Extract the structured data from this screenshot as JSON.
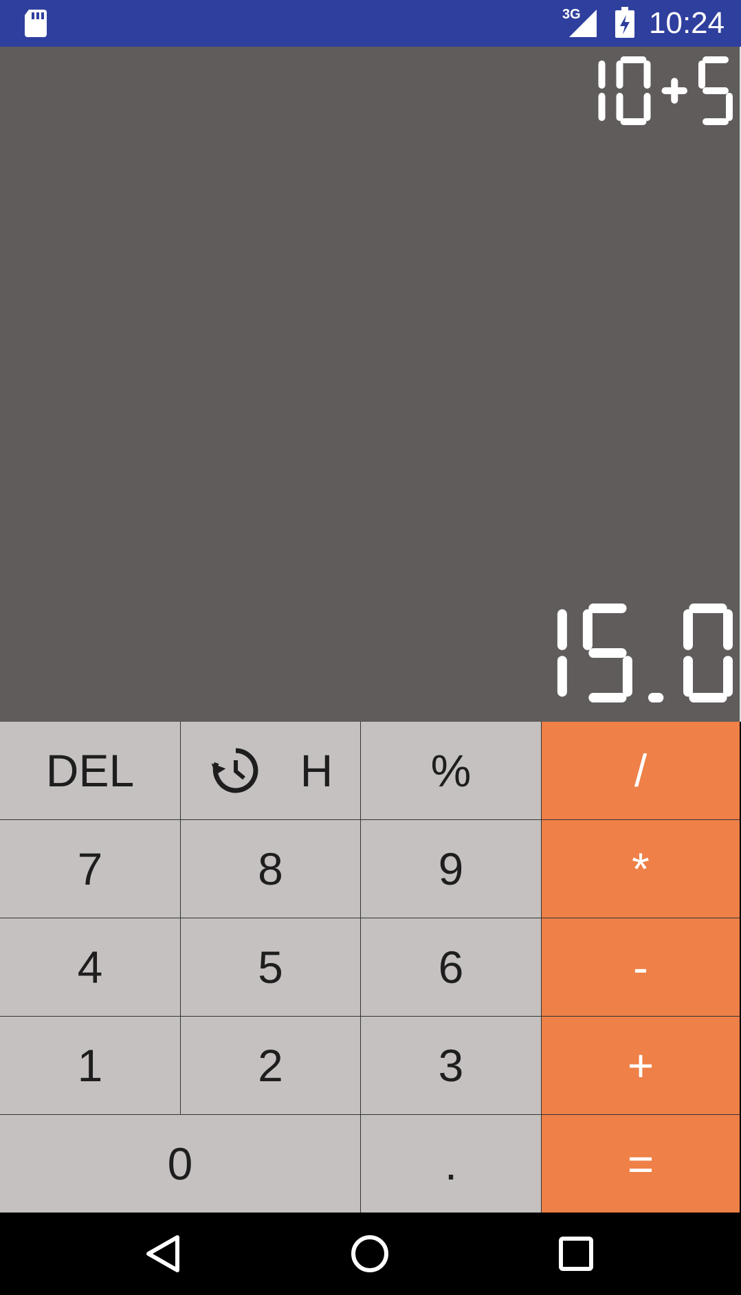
{
  "status_bar": {
    "network": "3G",
    "time": "10:24",
    "icons": [
      "sd-card-icon",
      "signal-icon",
      "battery-charging-icon"
    ]
  },
  "display": {
    "expression": "10+5",
    "result": "15.0"
  },
  "keypad": {
    "rows": [
      [
        "DEL",
        "H",
        "%",
        "/"
      ],
      [
        "7",
        "8",
        "9",
        "*"
      ],
      [
        "4",
        "5",
        "6",
        "-"
      ],
      [
        "1",
        "2",
        "3",
        "+"
      ],
      [
        "0",
        ".",
        "="
      ]
    ]
  },
  "colors": {
    "status_bar": "#2f3f9e",
    "display_bg": "#605c5b",
    "key_bg": "#c5c1c0",
    "operator_bg": "#ee8048"
  },
  "nav_bar": {
    "icons": [
      "back-icon",
      "home-icon",
      "recents-icon"
    ]
  }
}
